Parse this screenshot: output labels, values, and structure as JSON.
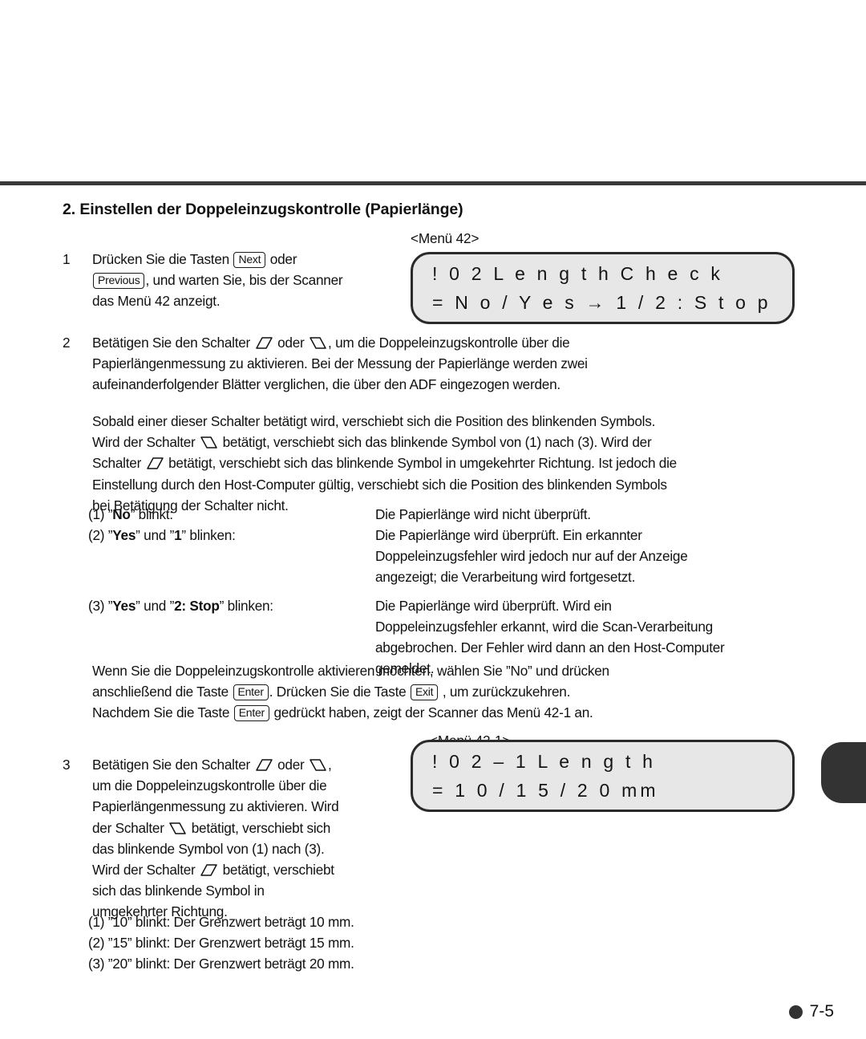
{
  "page": {
    "footer_page_number": "7-5",
    "footer_bullet_icon": "filled-circle-bullet"
  },
  "section": {
    "heading": "2. Einstellen der Doppeleinzugskontrolle (Papierlänge)"
  },
  "steps": {
    "step1": {
      "number": "1",
      "text_before_next": "Drücken Sie die Tasten ",
      "key_next": "Next",
      "text_after_next": " oder",
      "key_previous": "Previous",
      "text_line2": ", und warten Sie, bis der Scanner",
      "text_line3": "das Menü 42 anzeigt."
    },
    "step2": {
      "number": "2",
      "line1_a": "Betätigen Sie den Schalter ",
      "line1_b": " oder ",
      "line1_c": ", um die Doppeleinzugskontrolle über die",
      "line2": "Papierlängenmessung zu aktivieren.  Bei der Messung der Papierlänge werden zwei",
      "line3": "aufeinanderfolgender Blätter verglichen, die über den ADF eingezogen werden."
    },
    "step3": {
      "number": "3",
      "line1_a": "Betätigen Sie den Schalter ",
      "line1_b": " oder ",
      "line1_c": ",",
      "line2": "um die Doppeleinzugskontrolle über die",
      "line3": "Papierlängenmessung zu aktivieren. Wird",
      "line4_a": "der Schalter ",
      "line4_b": " betätigt, verschiebt sich",
      "line5": "das blinkende Symbol von (1) nach (3).",
      "line6_a": "Wird der Schalter ",
      "line6_b": " betätigt, verschiebt",
      "line7": "sich das blinkende Symbol in",
      "line8": "umgekehrter Richtung."
    }
  },
  "paragraphs": {
    "blink_behaviour": {
      "line1": "Sobald einer dieser Schalter betätigt wird, verschiebt sich die Position des blinkenden Symbols.",
      "line2_a": "Wird der Schalter ",
      "line2_b": " betätigt, verschiebt sich das blinkende Symbol von (1) nach (3). Wird der",
      "line3_a": "Schalter ",
      "line3_b": " betätigt, verschiebt sich das blinkende Symbol in umgekehrter Richtung. Ist jedoch die",
      "line4": "Einstellung durch den Host-Computer gültig, verschiebt sich die Position des blinkenden Symbols",
      "line5": "bei Betätigung der Schalter nicht."
    },
    "enter_exit": {
      "line1": "Wenn Sie die Doppeleinzugskontrolle aktivieren möchten, wählen Sie ”No” und drücken",
      "line2_a": "anschließend die Taste ",
      "key_enter": "Enter",
      "line2_b": ". Drücken Sie die Taste ",
      "key_exit": "Exit",
      "line2_c": " , um zurückzukehren.",
      "line3_a": "Nachdem Sie die Taste ",
      "key_enter2": "Enter",
      "line3_b": " gedrückt haben, zeigt der Scanner das Menü 42-1 an."
    }
  },
  "blink_options_menu42": [
    {
      "label_prefix": "(1) ”",
      "label_bold": "No",
      "label_suffix": "” blinkt:",
      "description": [
        "Die Papierlänge wird nicht überprüft."
      ]
    },
    {
      "label_prefix": "(2) ”",
      "label_bold": "Yes",
      "label_mid": "” und ”",
      "label_bold2": "1",
      "label_suffix": "” blinken:",
      "description": [
        "Die Papierlänge wird überprüft.  Ein erkannter",
        "Doppeleinzugsfehler wird jedoch nur auf der Anzeige",
        "angezeigt; die Verarbeitung wird fortgesetzt."
      ]
    },
    {
      "label_prefix": "(3) ”",
      "label_bold": "Yes",
      "label_mid": "” und ”",
      "label_bold2": "2: Stop",
      "label_suffix": "” blinken:",
      "description": [
        "Die Papierlänge wird überprüft.  Wird ein",
        "Doppeleinzugsfehler erkannt, wird die Scan-Verarbeitung",
        "abgebrochen.  Der Fehler wird dann an den Host-Computer",
        "gemeldet."
      ]
    }
  ],
  "blink_options_menu42_1": [
    "(1) ”10” blinkt: Der Grenzwert beträgt 10 mm.",
    "(2) ”15” blinkt: Der Grenzwert beträgt 15 mm.",
    "(3) ”20” blinkt: Der Grenzwert beträgt 20 mm."
  ],
  "lcd_panels": [
    {
      "caption": "<Menü 42>",
      "line1": "! 0 2   L e n g t h   C h e c k",
      "line2": "= N o / Y e s   →   1 / 2 : S t o p"
    },
    {
      "caption": "<Menü 42-1>",
      "line1": "! 0 2 – 1   L e n g t h",
      "line2": "=   1 0 / 1 5 / 2 0   mm"
    }
  ],
  "icons": {
    "switch_left": "diamond-switch-left-icon",
    "switch_right": "diamond-switch-right-icon",
    "arrow_right": "arrow-right-icon",
    "thumb_tab": "page-thumb-tab-icon"
  },
  "colors": {
    "rule": "#3a3a3a",
    "lcd_fill": "#e7e7e7",
    "lcd_border": "#2a2a2a",
    "tab": "#333333",
    "text": "#111111"
  }
}
